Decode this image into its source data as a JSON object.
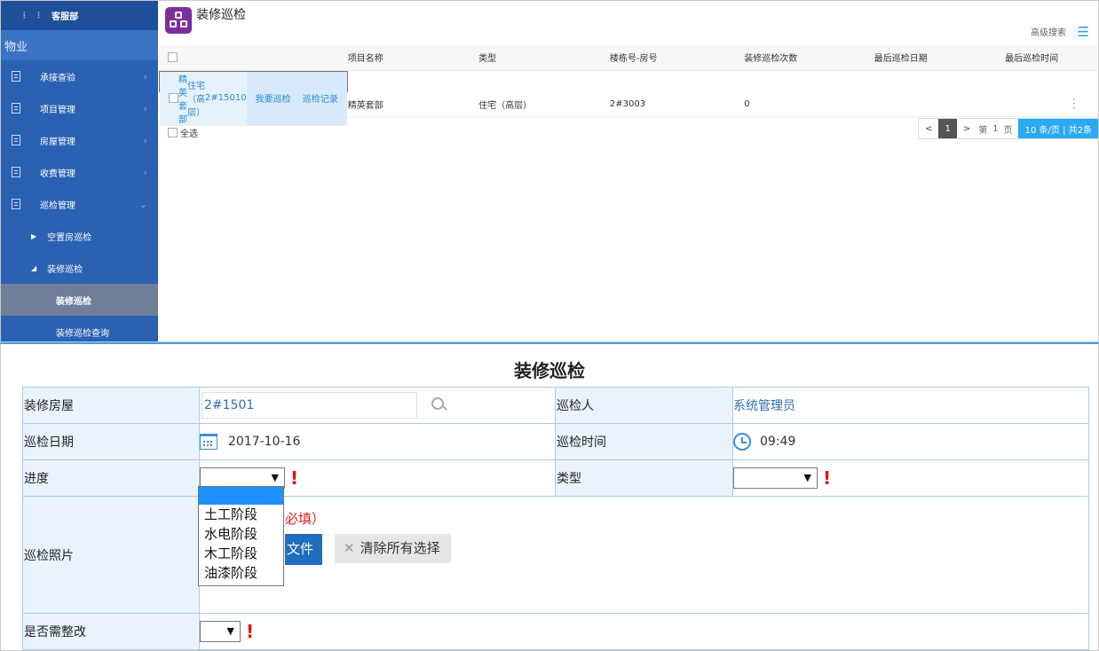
{
  "sidebar": {
    "header": "客服部",
    "section": "物业",
    "items": [
      {
        "label": "承接查验"
      },
      {
        "label": "项目管理"
      },
      {
        "label": "房屋管理"
      },
      {
        "label": "收费管理"
      },
      {
        "label": "巡检管理"
      }
    ],
    "sub_items": [
      {
        "label": "空置房巡检"
      },
      {
        "label": "装修巡检"
      }
    ],
    "sub2_items": [
      {
        "label": "装修巡检"
      },
      {
        "label": "装修巡检查询"
      }
    ]
  },
  "page": {
    "title": "装修巡检",
    "advanced_search": "高级搜索"
  },
  "grid": {
    "columns": [
      "项目名称",
      "类型",
      "楼栋号-房号",
      "装修巡检次数",
      "最后巡检日期",
      "最后巡检时间"
    ],
    "rows": [
      {
        "project": "精英套部",
        "type": "住宅（高层）",
        "room": "2#1501",
        "count": "0",
        "last_date": "",
        "last_time": ""
      },
      {
        "project": "精英套部",
        "type": "住宅（高层）",
        "room": "2#3003",
        "count": "0",
        "last_date": "",
        "last_time": ""
      }
    ],
    "row_actions": [
      "我要巡检",
      "巡检记录"
    ],
    "select_all": "全选"
  },
  "pager": {
    "prev": "<",
    "current": "1",
    "next": ">",
    "di": "第",
    "page_no": "1",
    "ye": "页",
    "size_info": "10  条/页 | 共2条"
  },
  "form": {
    "title": "装修巡检",
    "room_label": "装修房屋",
    "room_value": "2#1501",
    "inspector_label": "巡检人",
    "inspector_value": "系统管理员",
    "date_label": "巡检日期",
    "date_value": "2017-10-16",
    "time_label": "巡检时间",
    "time_value": "09:49",
    "progress_label": "进度",
    "type_label": "类型",
    "photo_label": "巡检照片",
    "required_note": "必填）",
    "upload_label": "文件",
    "clear_label": "清除所有选择",
    "rectify_label": "是否需整改",
    "progress_options": [
      "土工阶段",
      "水电阶段",
      "木工阶段",
      "油漆阶段"
    ]
  },
  "colors": {
    "sidebar": "#2a61b2",
    "accent": "#2aaaf0",
    "required": "#e01010"
  }
}
